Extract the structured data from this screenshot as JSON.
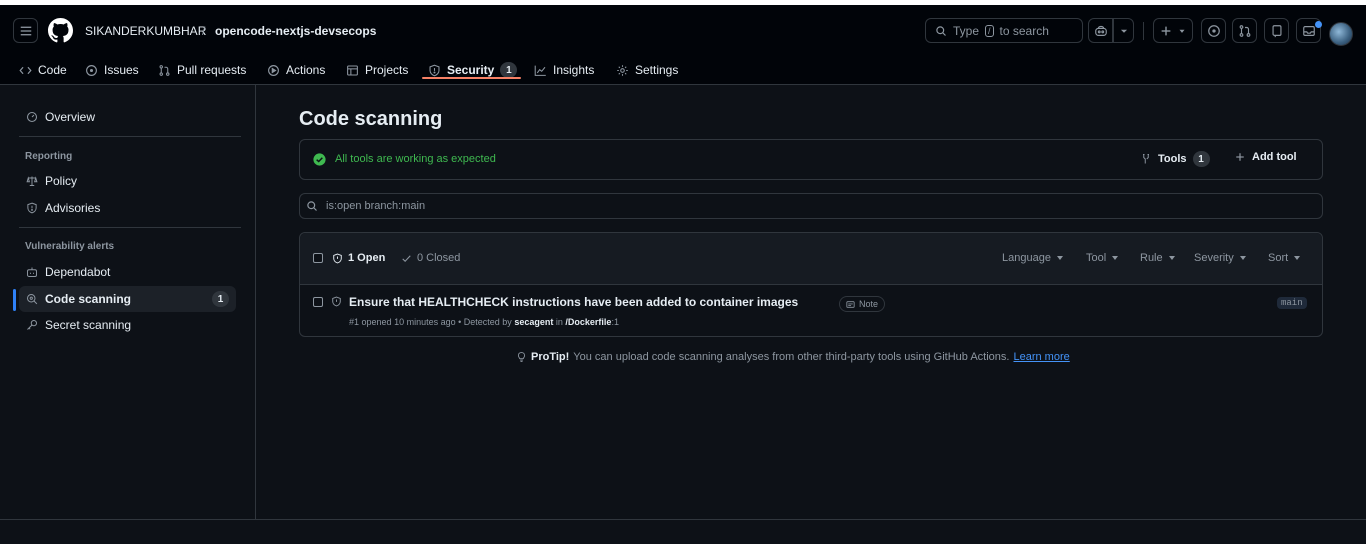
{
  "header": {
    "owner": "SIKANDERKUMBHAR",
    "separator": "/",
    "repo": "opencode-nextjs-devsecops",
    "search_prefix": "Type",
    "search_key": "/",
    "search_suffix": "to search"
  },
  "tabs": [
    {
      "label": "Code",
      "icon": "code-icon"
    },
    {
      "label": "Issues",
      "icon": "issue-icon"
    },
    {
      "label": "Pull requests",
      "icon": "pull-request-icon"
    },
    {
      "label": "Actions",
      "icon": "play-icon"
    },
    {
      "label": "Projects",
      "icon": "table-icon"
    },
    {
      "label": "Security",
      "icon": "shield-icon",
      "count": "1",
      "active": true
    },
    {
      "label": "Insights",
      "icon": "graph-icon"
    },
    {
      "label": "Settings",
      "icon": "gear-icon"
    }
  ],
  "sidebar": {
    "overview": "Overview",
    "reporting_label": "Reporting",
    "policy": "Policy",
    "advisories": "Advisories",
    "vuln_label": "Vulnerability alerts",
    "dependabot": "Dependabot",
    "code_scanning": "Code scanning",
    "code_scanning_count": "1",
    "secret_scanning": "Secret scanning"
  },
  "main": {
    "title": "Code scanning",
    "status": "All tools are working as expected",
    "tools_label": "Tools",
    "tools_count": "1",
    "add_tool_label": "Add tool",
    "filter_value": "is:open branch:main",
    "open_label": "1 Open",
    "closed_label": "0 Closed",
    "filters": [
      "Language",
      "Tool",
      "Rule",
      "Severity",
      "Sort"
    ],
    "alert": {
      "title": "Ensure that HEALTHCHECK instructions have been added to container images",
      "severity": "Note",
      "number": "#1",
      "opened": "opened 10 minutes ago",
      "detected_prefix": "• Detected by",
      "tool": "secagent",
      "in_word": "in",
      "path": "/Dockerfile",
      "line": ":1",
      "branch": "main"
    },
    "protip_label": "ProTip!",
    "protip_text": "You can upload code scanning analyses from other third-party tools using GitHub Actions.",
    "protip_link": "Learn more"
  },
  "colors": {
    "accent": "#f78166",
    "link": "#4493f8",
    "success": "#3fb950",
    "background": "#0d1117"
  }
}
